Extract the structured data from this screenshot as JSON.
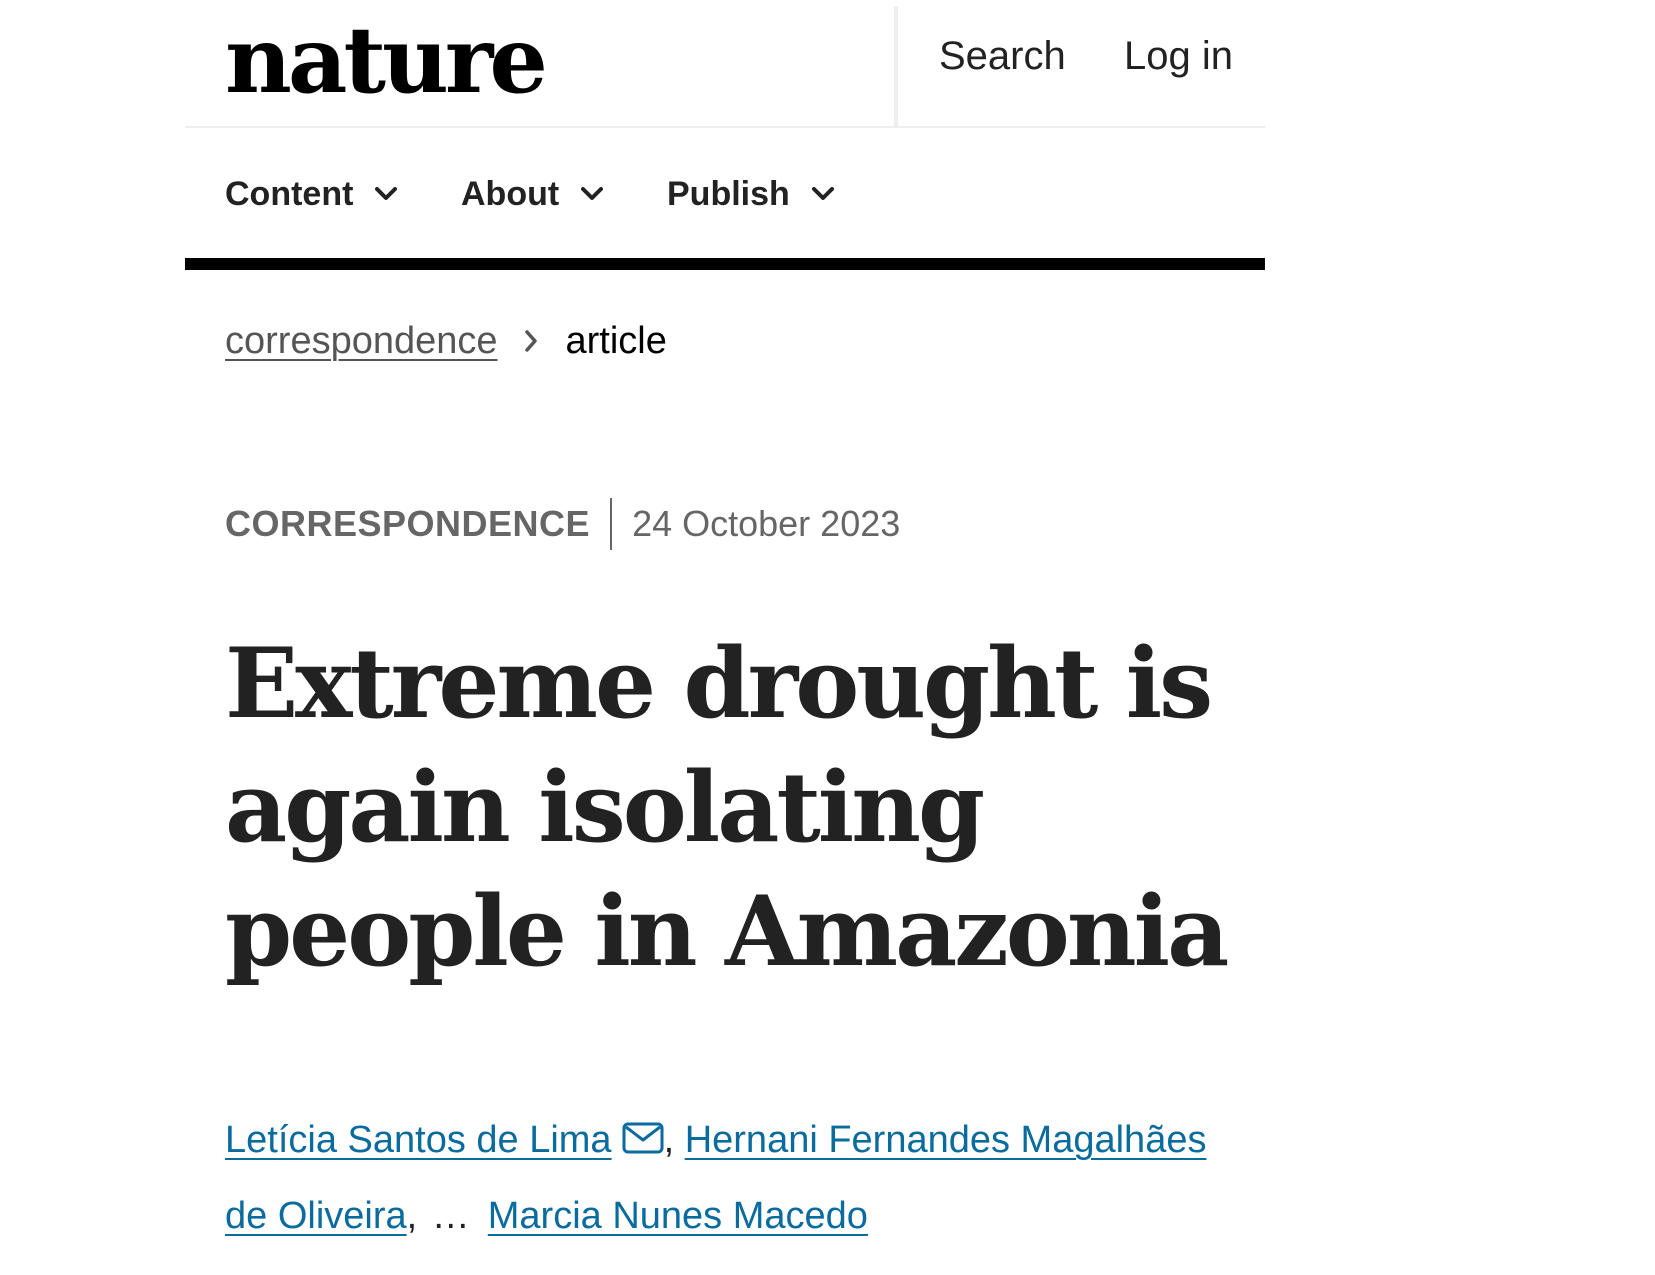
{
  "header": {
    "logo": "nature",
    "search_label": "Search",
    "login_label": "Log in"
  },
  "nav": {
    "items": [
      {
        "label": "Content",
        "icon": "chevron-down-icon"
      },
      {
        "label": "About",
        "icon": "chevron-down-icon"
      },
      {
        "label": "Publish",
        "icon": "chevron-down-icon"
      }
    ]
  },
  "breadcrumb": {
    "parent": "correspondence",
    "separator_icon": "chevron-right-icon",
    "current": "article"
  },
  "article": {
    "type": "CORRESPONDENCE",
    "date": "24 October 2023",
    "title": "Extreme drought is again isolating people in Amazonia",
    "authors": [
      {
        "name": "Letícia Santos de Lima",
        "icon": "mail-icon"
      },
      {
        "name": "Hernani Fernandes Magalhães de Oliveira"
      },
      {
        "name": "Marcia Nunes Macedo"
      }
    ],
    "author_separator": ",",
    "author_ellipsis": "…"
  },
  "colors": {
    "link": "#0a6b9f",
    "text": "#222222",
    "muted": "#666666",
    "nav_rule": "#000000"
  }
}
